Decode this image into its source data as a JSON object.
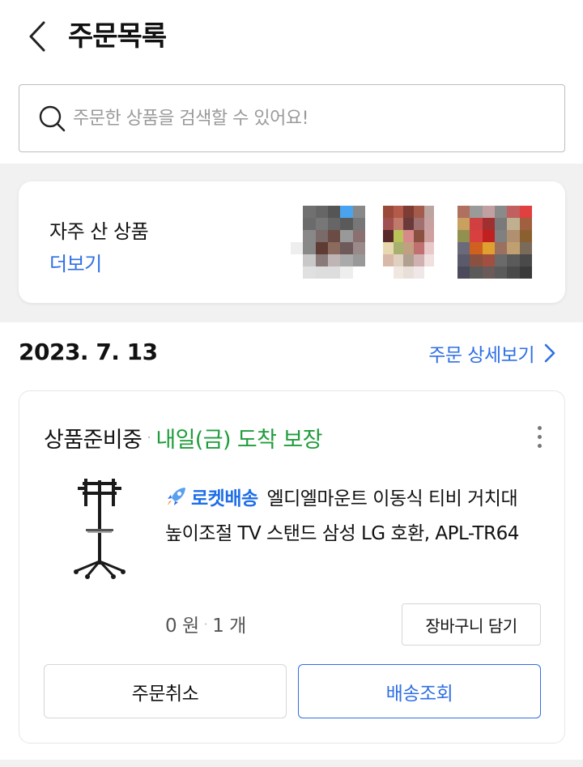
{
  "header": {
    "title": "주문목록",
    "back_icon": "chevron-left-icon"
  },
  "search": {
    "placeholder": "주문한 상품을 검색할 수 있어요!",
    "value": "",
    "icon": "search-icon"
  },
  "frequent": {
    "title": "자주 산 상품",
    "more_label": "더보기",
    "thumbnails": [
      {
        "colors": [
          "#ffffff",
          "#707070",
          "#666",
          "#555",
          "#4aa3ee",
          "#888",
          "#fff",
          "#6b6b6b",
          "#777",
          "#666",
          "#5a5a5a",
          "#777",
          "#fff",
          "#888",
          "#7a6a6a",
          "#6b4c44",
          "#999",
          "#8a7070",
          "#eee",
          "#888",
          "#5e3b33",
          "#8a6b5e",
          "#6e5a5a",
          "#9a8a8a",
          "#fff",
          "#c8c8c8",
          "#8a7a7a",
          "#c0b5b5",
          "#aaa",
          "#999",
          "#fff",
          "#e0e0e0",
          "#ddd",
          "#ddd",
          "#eee",
          "#fff"
        ]
      },
      {
        "colors": [
          "#9b4a3a",
          "#b45a4a",
          "#7d3c34",
          "#a55b4b",
          "#bca5a0",
          "#fff",
          "#a05050",
          "#c07a6a",
          "#6a3a3a",
          "#a07070",
          "#c8a0a0",
          "#fff",
          "#5a2a2a",
          "#b9c35a",
          "#d88a8a",
          "#8a5040",
          "#d0a0a0",
          "#fff",
          "#e8d8b0",
          "#a8b070",
          "#c0a080",
          "#c07070",
          "#e8c8c8",
          "#fff",
          "#d8b8a8",
          "#e0d0c0",
          "#b0a090",
          "#d0b0b0",
          "#f0e0e0",
          "#fff",
          "#fff",
          "#f0e8e0",
          "#e8e0d8",
          "#f0e8e8",
          "#fff",
          "#fff"
        ]
      },
      {
        "colors": [
          "#b07060",
          "#9a9a9a",
          "#c0a0a0",
          "#8a8a8a",
          "#c06060",
          "#e04040",
          "#c8a060",
          "#d04040",
          "#a03030",
          "#7a7a7a",
          "#c0b090",
          "#a06040",
          "#909050",
          "#d84040",
          "#c02020",
          "#808080",
          "#b09070",
          "#8a6030",
          "#6a6a7a",
          "#d06020",
          "#e0a030",
          "#9a7060",
          "#c0a070",
          "#7a6a5a",
          "#5a5a6a",
          "#8a5040",
          "#a05040",
          "#6a6a6a",
          "#5a5a5a",
          "#4a4a4a",
          "#4a4a5a",
          "#5a5a5a",
          "#6a5a5a",
          "#5a5a5a",
          "#4a4a4a",
          "#3a3a3a"
        ]
      }
    ]
  },
  "order": {
    "date": "2023. 7. 13",
    "detail_label": "주문 상세보기",
    "status": "상품준비중",
    "status_separator": "·",
    "delivery_promise": "내일(금) 도착 보장",
    "rocket_label": "로켓배송",
    "product_name": "엘디엘마운트 이동식 티비 거치대 높이조절 TV 스탠드 삼성 LG 호환, APL-TR64",
    "price": "0 원",
    "quantity": "1 개",
    "price_separator": "·",
    "cart_button": "장바구니 담기",
    "cancel_button": "주문취소",
    "track_button": "배송조회"
  },
  "colors": {
    "accent_blue": "#2f6fe4",
    "status_green": "#1f9d3b",
    "band_gray": "#f1f1f1"
  }
}
